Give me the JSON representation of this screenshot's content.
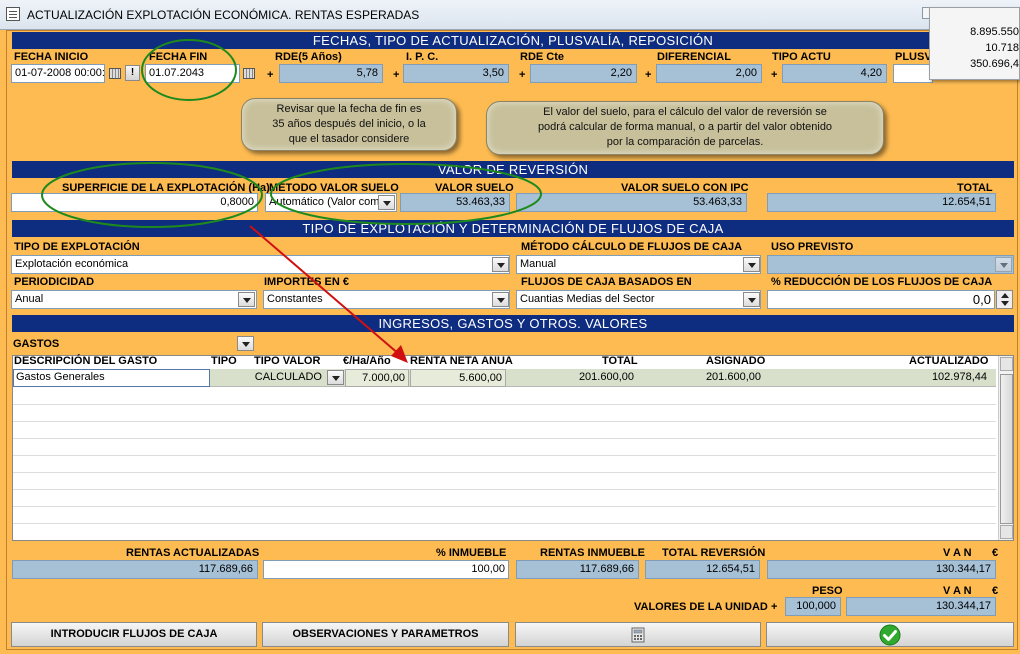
{
  "window": {
    "title": "ACTUALIZACIÓN EXPLOTACIÓN ECONÓMICA. RENTAS ESPERADAS"
  },
  "popup": {
    "values": [
      "8.895.550",
      "10.718",
      "350.696,4"
    ]
  },
  "section1": {
    "title": "FECHAS, TIPO DE ACTUALIZACIÓN, PLUSVALÍA, REPOSICIÓN",
    "fecha_inicio_label": "FECHA  INICIO",
    "fecha_inicio_value": "01-07-2008 00:00:0",
    "info_button": "!",
    "fecha_fin_label": "FECHA FIN",
    "fecha_fin_value": "01.07.2043",
    "rde5_label": "RDE(5 Años)",
    "rde5_value": "5,78",
    "ipc_label": "I. P. C.",
    "ipc_value": "3,50",
    "rdecte_label": "RDE Cte",
    "rdecte_value": "2,20",
    "diferencial_label": "DIFERENCIAL",
    "diferencial_value": "2,00",
    "tipoactu_label": "TIPO ACTU",
    "tipoactu_value": "4,20",
    "plusv_label": "PLUSV",
    "plus": "+"
  },
  "notes": {
    "note1": [
      "Revisar que la fecha de fin es",
      "35 años después del inicio, o la",
      "que el tasador considere"
    ],
    "note2": [
      "El valor del suelo, para el cálculo del valor de reversión se",
      "podrá calcular de forma manual, o a partir del valor obtenido",
      "por la comparación de parcelas."
    ]
  },
  "section2": {
    "title": "VALOR DE REVERSIÓN",
    "superficie_label": "SUPERFICIE DE LA EXPLOTACIÓN (Ha)",
    "superficie_value": "0,8000",
    "metodo_label": "MÉTODO VALOR SUELO",
    "metodo_value": "Automático (Valor com",
    "valorsuelo_label": "VALOR SUELO",
    "valorsuelo_value": "53.463,33",
    "valorsueloipc_label": "VALOR SUELO CON IPC",
    "valorsueloipc_value": "53.463,33",
    "total_label": "TOTAL",
    "total_value": "12.654,51"
  },
  "section3": {
    "title": "TIPO DE EXPLOTACIÓN Y DETERMINACIÓN DE FLUJOS DE CAJA",
    "tipoexpl_label": "TIPO DE EXPLOTACIÓN",
    "tipoexpl_value": "Explotación económica",
    "metodoflujos_label": "MÉTODO CÁLCULO DE FLUJOS DE CAJA",
    "metodoflujos_value": "Manual",
    "uso_label": "USO PREVISTO",
    "uso_value": "",
    "periodicidad_label": "PERIODICIDAD",
    "periodicidad_value": "Anual",
    "importes_label": "IMPORTES EN €",
    "importes_value": "Constantes",
    "flujosbasados_label": "FLUJOS DE CAJA BASADOS EN",
    "flujosbasados_value": "Cuantias Medias del Sector",
    "reduccion_label": "% REDUCCIÓN DE LOS FLUJOS DE CAJA",
    "reduccion_value": "0,0"
  },
  "section4": {
    "title": "INGRESOS, GASTOS Y OTROS. VALORES",
    "category_value": "GASTOS",
    "columns": [
      "DESCRIPCIÓN DEL GASTO",
      "TIPO",
      "TIPO VALOR",
      "€/Ha/Año",
      "RENTA NETA ANUA",
      "TOTAL",
      "ASIGNADO",
      "ACTUALIZADO"
    ],
    "rows": [
      {
        "descripcion": "Gastos Generales",
        "tipo": "",
        "tipo_valor": "CALCULADO",
        "eur_ha": "7.000,00",
        "renta": "5.600,00",
        "total": "201.600,00",
        "asignado": "201.600,00",
        "actualizado": "102.978,44"
      }
    ]
  },
  "summary": {
    "rentas_act_label": "RENTAS ACTUALIZADAS",
    "rentas_act_value": "117.689,66",
    "pct_inmueble_label": "% INMUEBLE",
    "pct_inmueble_value": "100,00",
    "rentas_inm_label": "RENTAS INMUEBLE",
    "rentas_inm_value": "117.689,66",
    "total_rev_label": "TOTAL REVERSIÓN",
    "total_rev_value": "12.654,51",
    "van_label": "V A N",
    "euro": "€",
    "van_value": "130.344,17",
    "peso_label": "PESO",
    "van2_label": "V A N",
    "valores_label": "VALORES DE LA UNIDAD",
    "plus": "+",
    "peso_value": "100,000",
    "van2_value": "130.344,17"
  },
  "buttons": {
    "introducir": "INTRODUCIR FLUJOS DE CAJA",
    "observaciones": "OBSERVACIONES Y PARAMETROS"
  },
  "colors": {
    "background": "#FDBB52",
    "header": "#0E2C80",
    "readonly": "#A6C0D6",
    "annotation_ellipse": "#1E8A1E",
    "annotation_arrow": "#D01010"
  },
  "icons": [
    "calendar-icon",
    "calculator-icon",
    "check-icon",
    "chevron-down-icon"
  ]
}
